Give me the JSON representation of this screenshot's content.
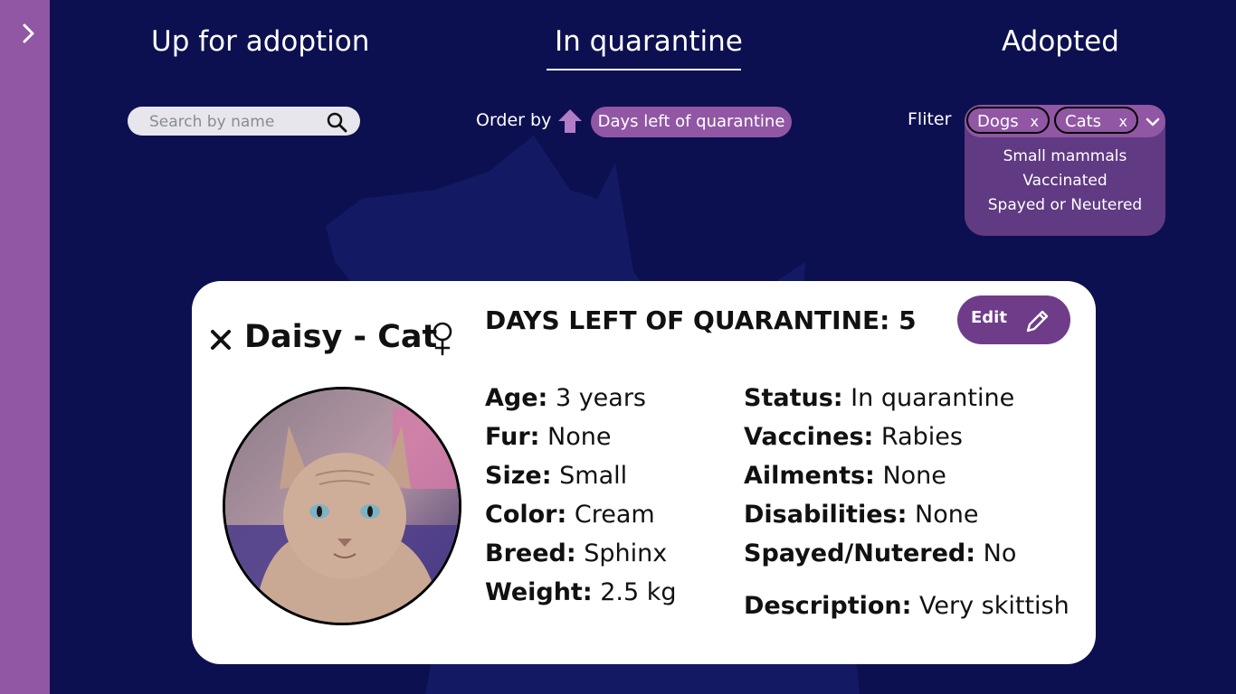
{
  "tabs": [
    {
      "label": "Up for adoption"
    },
    {
      "label": "In quarantine"
    },
    {
      "label": "Adopted"
    }
  ],
  "search": {
    "placeholder": "Search by name"
  },
  "order": {
    "label": "Order by",
    "value": "Days left of quarantine"
  },
  "filter": {
    "label": "Fliter",
    "selected": [
      {
        "label": "Dogs",
        "remove": "x"
      },
      {
        "label": "Cats",
        "remove": "x"
      }
    ],
    "options": [
      "Small mammals",
      "Vaccinated",
      "Spayed or Neutered"
    ]
  },
  "card": {
    "title": "Daisy - Cat",
    "days_left": "DAYS LEFT OF QUARANTINE: 5",
    "edit_label": "Edit",
    "left_fields": [
      {
        "label": "Age:",
        "value": "3 years"
      },
      {
        "label": "Fur:",
        "value": "None"
      },
      {
        "label": "Size:",
        "value": "Small"
      },
      {
        "label": "Color:",
        "value": "Cream"
      },
      {
        "label": "Breed:",
        "value": "Sphinx"
      },
      {
        "label": "Weight:",
        "value": "2.5 kg"
      }
    ],
    "right_fields": [
      {
        "label": "Status:",
        "value": "In quarantine"
      },
      {
        "label": "Vaccines:",
        "value": "Rabies"
      },
      {
        "label": "Ailments:",
        "value": "None"
      },
      {
        "label": "Disabilities:",
        "value": "None"
      },
      {
        "label": "Spayed/Nutered:",
        "value": "No"
      },
      {
        "label": "Description:",
        "value": "Very skittish"
      }
    ]
  },
  "colors": {
    "background": "#0d1050",
    "sidebar": "#9156a4",
    "accent": "#9156a4",
    "edit_button": "#6f3c8a",
    "card": "#ffffff"
  }
}
